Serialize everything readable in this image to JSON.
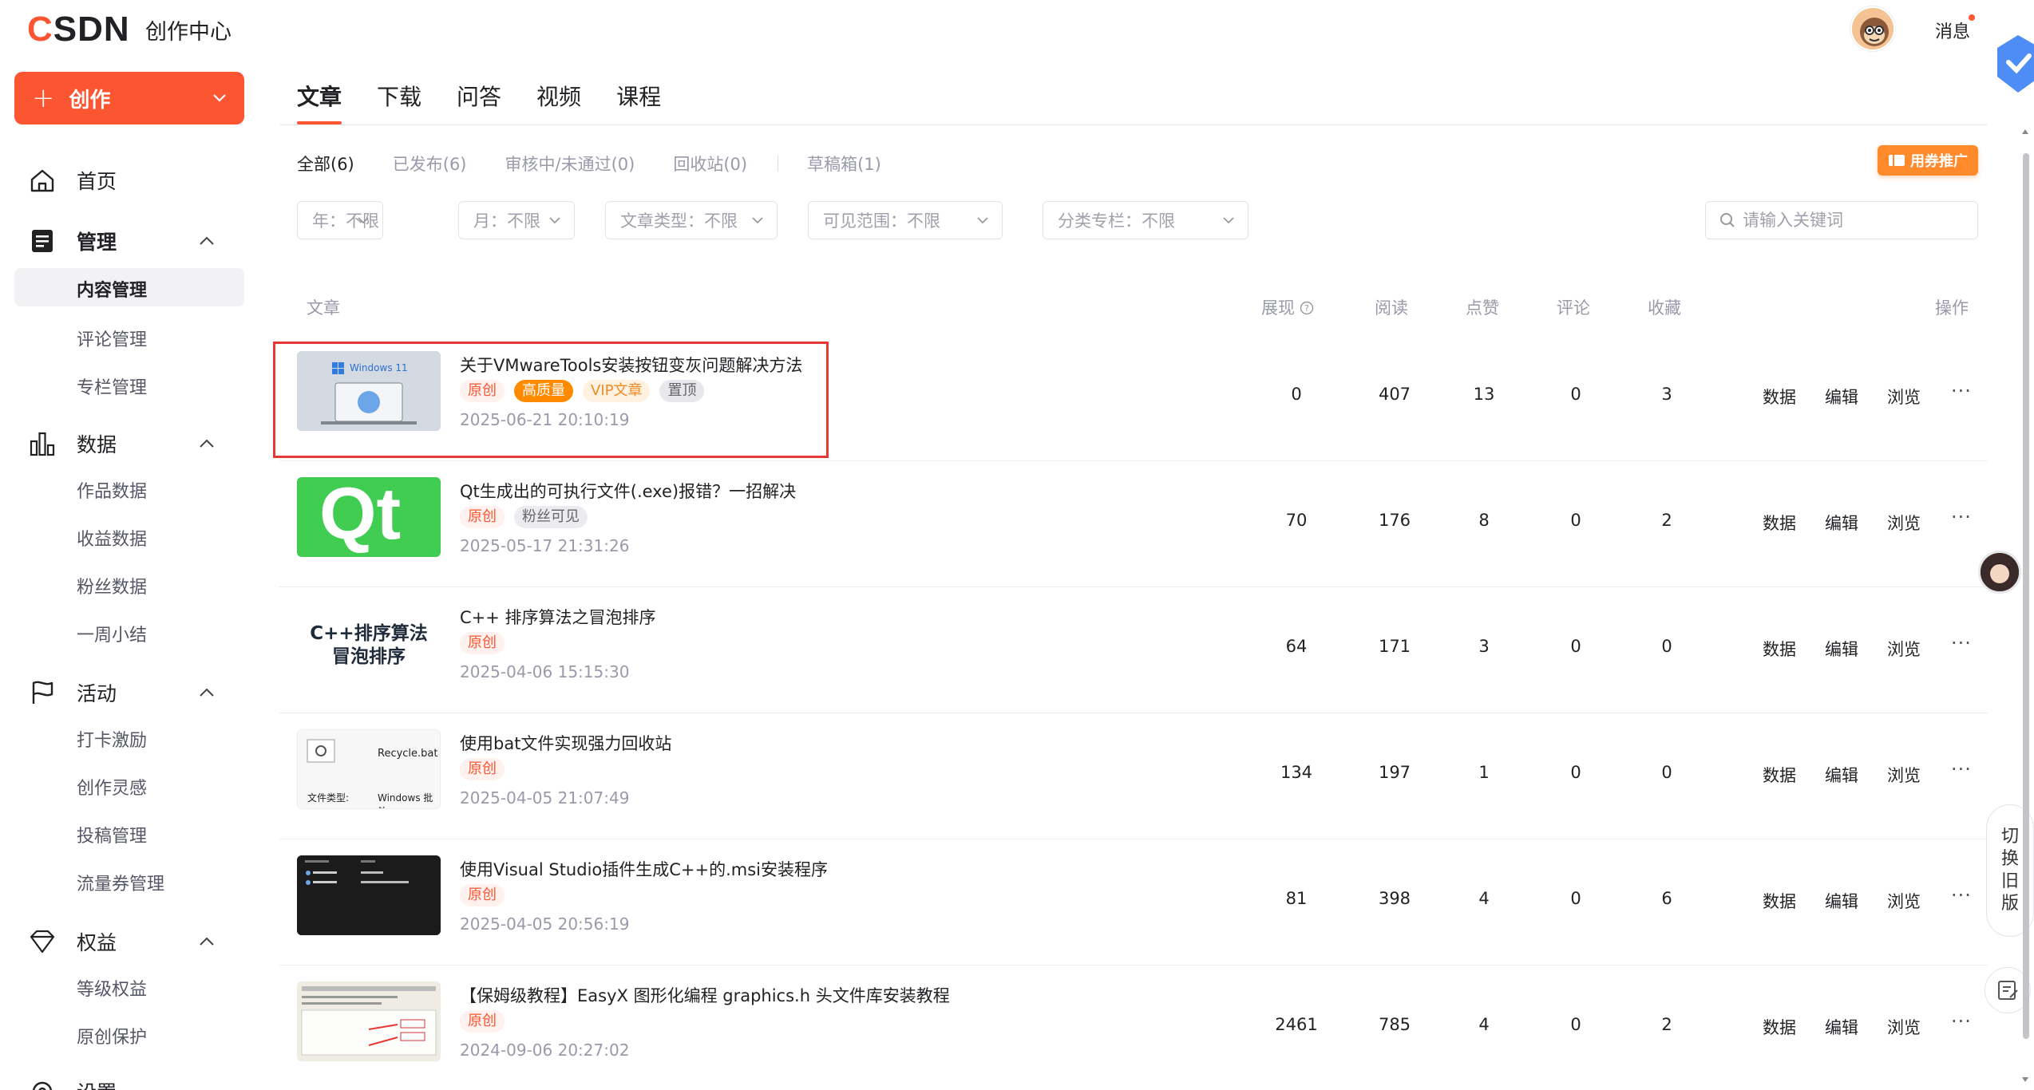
{
  "header": {
    "logo_c": "C",
    "logo_rest": "SDN",
    "center_title": "创作中心",
    "messages_label": "消息"
  },
  "sidebar": {
    "create_label": "创作",
    "home": "首页",
    "manage": {
      "label": "管理",
      "items": [
        "内容管理",
        "评论管理",
        "专栏管理"
      ]
    },
    "data": {
      "label": "数据",
      "items": [
        "作品数据",
        "收益数据",
        "粉丝数据",
        "一周小结"
      ]
    },
    "activity": {
      "label": "活动",
      "items": [
        "打卡激励",
        "创作灵感",
        "投稿管理",
        "流量券管理"
      ]
    },
    "rights": {
      "label": "权益",
      "items": [
        "等级权益",
        "原创保护"
      ]
    },
    "settings": "设置"
  },
  "tabs": [
    "文章",
    "下载",
    "问答",
    "视频",
    "课程"
  ],
  "status_filters": [
    "全部(6)",
    "已发布(6)",
    "审核中/未通过(0)",
    "回收站(0)",
    "草稿箱(1)"
  ],
  "promo_label": "用券推广",
  "dropdowns": [
    "年：不限",
    "月：不限",
    "文章类型：不限",
    "可见范围：不限",
    "分类专栏：不限"
  ],
  "search": {
    "placeholder": "请输入关键词"
  },
  "table": {
    "headers": [
      "文章",
      "展现",
      "阅读",
      "点赞",
      "评论",
      "收藏",
      "操作"
    ],
    "actions": [
      "数据",
      "编辑",
      "浏览"
    ],
    "rows": [
      {
        "title": "关于VMwareTools安装按钮变灰问题解决方法",
        "tags": [
          "原创",
          "高质量",
          "VIP文章",
          "置顶"
        ],
        "date": "2025-06-21 20:10:19",
        "views": "0",
        "reads": "407",
        "likes": "13",
        "comments": "0",
        "favs": "3",
        "thumb_text": "Windows 11"
      },
      {
        "title": "Qt生成出的可执行文件(.exe)报错？一招解决",
        "tags": [
          "原创",
          "粉丝可见"
        ],
        "date": "2025-05-17 21:31:26",
        "views": "70",
        "reads": "176",
        "likes": "8",
        "comments": "0",
        "favs": "2",
        "thumb_text": "Qt"
      },
      {
        "title": "C++ 排序算法之冒泡排序",
        "tags": [
          "原创"
        ],
        "date": "2025-04-06 15:15:30",
        "views": "64",
        "reads": "171",
        "likes": "3",
        "comments": "0",
        "favs": "0",
        "thumb_text": "C++排序算法 冒泡排序"
      },
      {
        "title": "使用bat文件实现强力回收站",
        "tags": [
          "原创"
        ],
        "date": "2025-04-05 21:07:49",
        "views": "134",
        "reads": "197",
        "likes": "1",
        "comments": "0",
        "favs": "0",
        "thumb_text": "Recycle.bat",
        "thumb_text2": "文件类型:",
        "thumb_text3": "Windows 批处"
      },
      {
        "title": "使用Visual Studio插件生成C++的.msi安装程序",
        "tags": [
          "原创"
        ],
        "date": "2025-04-05 20:56:19",
        "views": "81",
        "reads": "398",
        "likes": "4",
        "comments": "0",
        "favs": "6",
        "thumb_text": ""
      },
      {
        "title": "【保姆级教程】EasyX 图形化编程 graphics.h 头文件库安装教程",
        "tags": [
          "原创"
        ],
        "date": "2024-09-06 20:27:02",
        "views": "2461",
        "reads": "785",
        "likes": "4",
        "comments": "0",
        "favs": "2",
        "thumb_text": ""
      }
    ]
  },
  "switch_old": [
    "切",
    "换",
    "旧",
    "版"
  ],
  "colors": {
    "brand": "#fc5531",
    "highlight": "#e53935"
  }
}
